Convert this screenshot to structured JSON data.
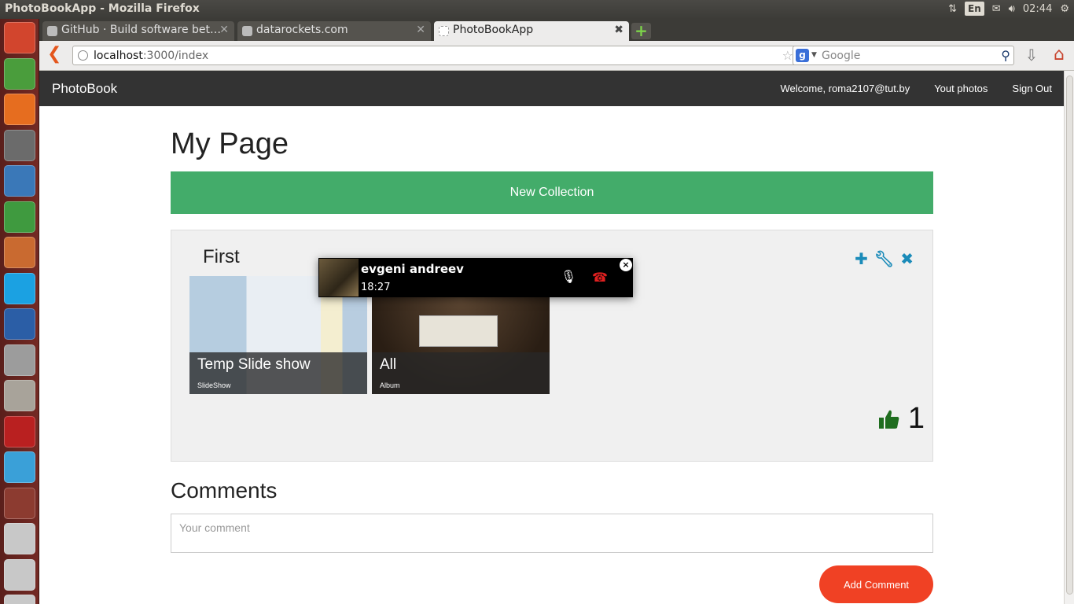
{
  "os_panel": {
    "window_title": "PhotoBookApp - Mozilla Firefox",
    "language": "En",
    "clock": "02:44"
  },
  "launcher": {
    "apps": [
      {
        "icon": "ubuntu-dash-icon",
        "color": "#d2452d"
      },
      {
        "icon": "chrome-icon",
        "color": "#4a9d3c"
      },
      {
        "icon": "firefox-icon",
        "color": "#e66d1f"
      },
      {
        "icon": "sublime-text-icon",
        "color": "#6b6b6b"
      },
      {
        "icon": "libreoffice-writer-icon",
        "color": "#3a78b8"
      },
      {
        "icon": "libreoffice-calc-icon",
        "color": "#3f9a3f"
      },
      {
        "icon": "libreoffice-impress-icon",
        "color": "#c96a30"
      },
      {
        "icon": "skype-icon",
        "color": "#1ba1e2"
      },
      {
        "icon": "thunderbird-icon",
        "color": "#2b5ea6"
      },
      {
        "icon": "system-settings-icon",
        "color": "#9c9c9c"
      },
      {
        "icon": "files-icon",
        "color": "#a8a39a"
      },
      {
        "icon": "workspace-app-icon",
        "color": "#b92020"
      },
      {
        "icon": "weather-icon",
        "color": "#3aa0d8"
      },
      {
        "icon": "workspace-switcher-icon",
        "color": "#8c3b30"
      },
      {
        "icon": "drive-icon",
        "color": "#c8c8c8"
      },
      {
        "icon": "drive-icon-2",
        "color": "#c8c8c8"
      },
      {
        "icon": "trash-icon",
        "color": "#c8c8c8"
      }
    ]
  },
  "browser": {
    "tabs": [
      {
        "label": "GitHub · Build software bet…",
        "active": false
      },
      {
        "label": "datarockets.com",
        "active": false
      },
      {
        "label": "PhotoBookApp",
        "active": true
      }
    ],
    "url_host": "localhost",
    "url_rest": ":3000/index",
    "search_placeholder": "Google"
  },
  "app": {
    "brand": "PhotoBook",
    "nav": {
      "welcome": "Welcome, roma2107@tut.by",
      "photos": "Yout photos",
      "signout": "Sign Out"
    },
    "page_title": "My Page",
    "new_collection": "New Collection",
    "collection": {
      "title": "First",
      "items": [
        {
          "title": "Temp Slide show",
          "type": "SlideShow"
        },
        {
          "title": "All",
          "type": "Album"
        }
      ],
      "likes": "1"
    },
    "comments_heading": "Comments",
    "comment_placeholder": "Your comment",
    "add_comment": "Add Comment"
  },
  "call_popup": {
    "caller": "evgeni andreev",
    "duration": "18:27"
  },
  "colors": {
    "nav_bg": "#333333",
    "success": "#43ac6a",
    "alert": "#f04124",
    "action_icons": "#1a8bb9",
    "like_icon": "#1f6d1f"
  }
}
